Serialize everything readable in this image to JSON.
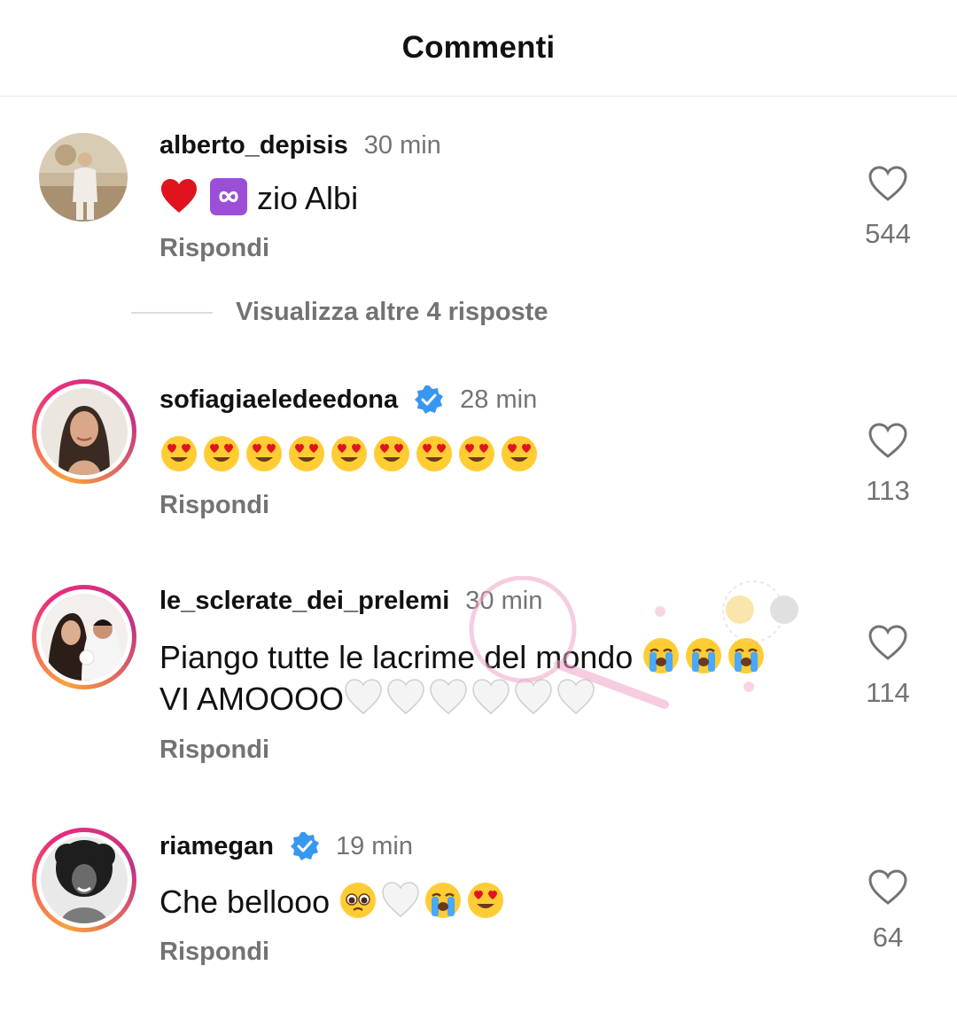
{
  "header": {
    "title": "Commenti"
  },
  "comments": [
    {
      "username": "alberto_depisis",
      "time": "30 min",
      "verified": false,
      "text": "zio Albi",
      "emojis": [
        "heart-red",
        "infinity"
      ],
      "reply_label": "Rispondi",
      "likes": "544"
    },
    {
      "username": "sofiagiaeledeedona",
      "time": "28 min",
      "verified": true,
      "text": "",
      "emojis": [
        "heart-eyes",
        "heart-eyes",
        "heart-eyes",
        "heart-eyes",
        "heart-eyes",
        "heart-eyes",
        "heart-eyes",
        "heart-eyes",
        "heart-eyes"
      ],
      "reply_label": "Rispondi",
      "likes": "113"
    },
    {
      "username": "le_sclerate_dei_prelemi",
      "time": "30 min",
      "verified": false,
      "text_line1": "Piango tutte le lacrime del mondo",
      "text_line2": "VI AMOOOO",
      "emojis_line1": [
        "crying",
        "crying",
        "crying"
      ],
      "emojis_line2": [
        "heart-white",
        "heart-white",
        "heart-white",
        "heart-white",
        "heart-white",
        "heart-white"
      ],
      "reply_label": "Rispondi",
      "likes": "114"
    },
    {
      "username": "riamegan",
      "time": "19 min",
      "verified": true,
      "text": "Che bellooo",
      "emojis": [
        "pleading",
        "heart-white",
        "crying",
        "heart-eyes"
      ],
      "reply_label": "Rispondi",
      "likes": "64"
    }
  ],
  "more_replies": {
    "label": "Visualizza altre 4 risposte"
  },
  "colors": {
    "text": "#111111",
    "secondary": "#737373",
    "verified": "#3897f0",
    "story_ring_start": "#f9a13a",
    "story_ring_end": "#c13584"
  }
}
